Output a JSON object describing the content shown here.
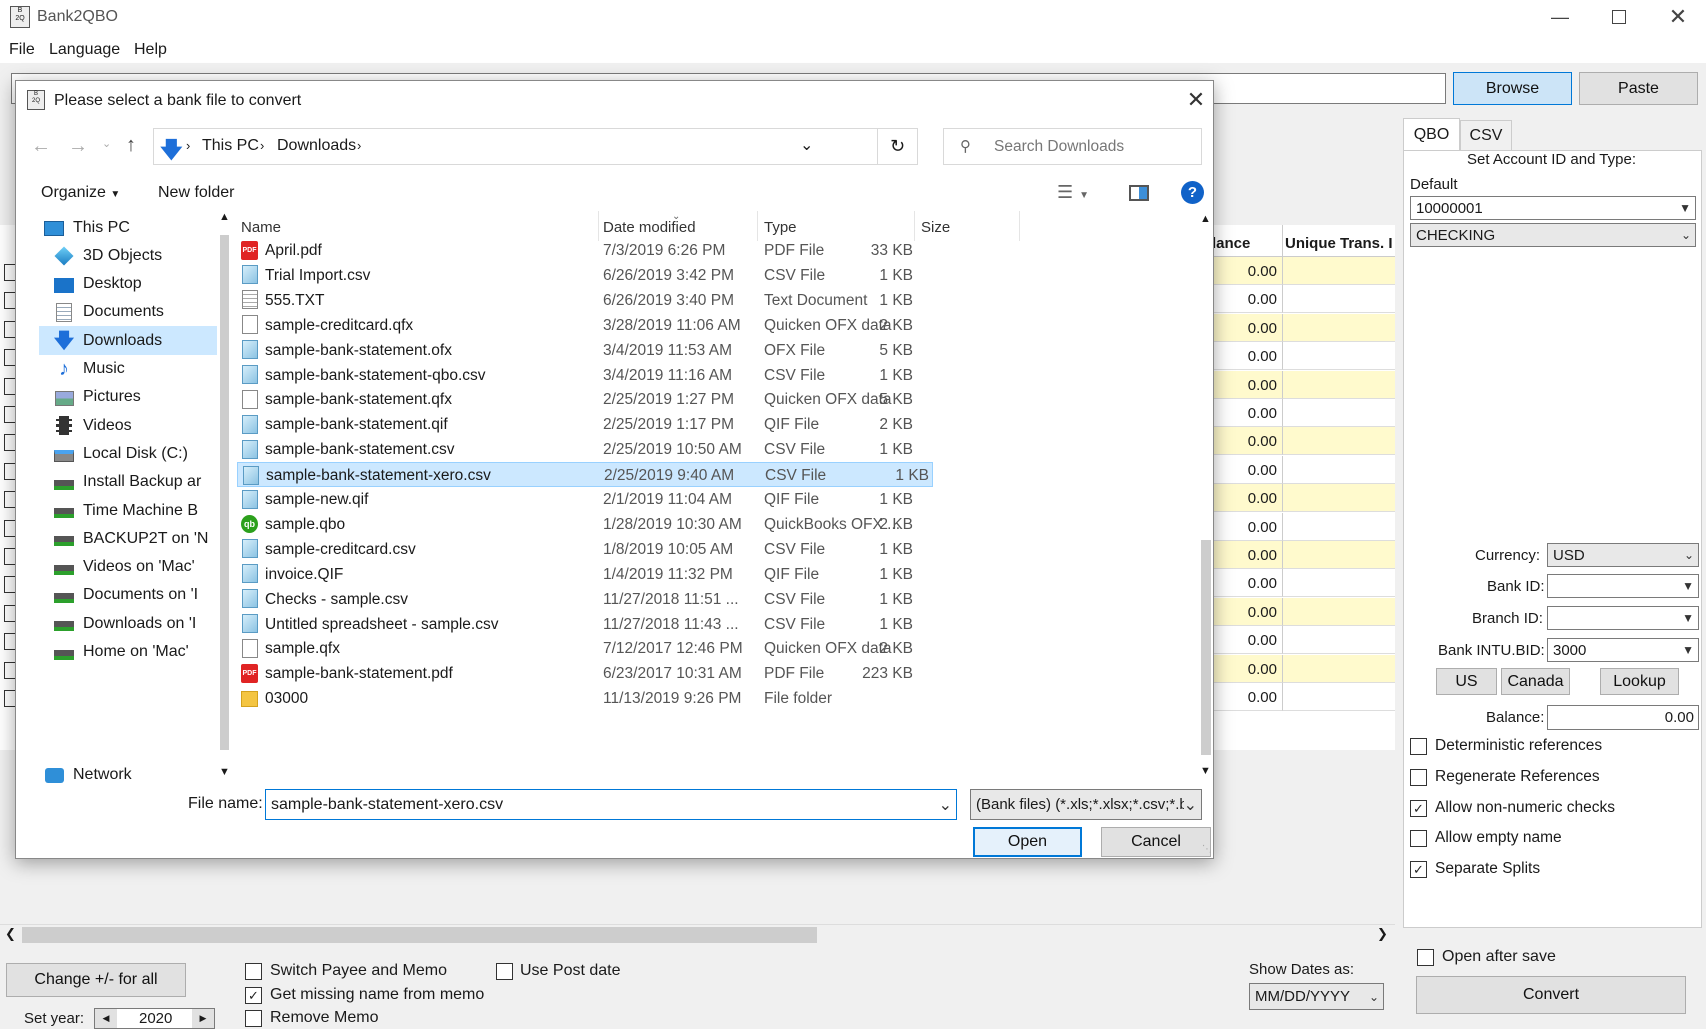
{
  "app": {
    "title": "Bank2QBO",
    "menu": [
      "File",
      "Language",
      "Help"
    ],
    "browse": "Browse",
    "paste": "Paste",
    "grid_headers": [
      "lance",
      "Unique Trans. I"
    ],
    "balances": [
      "0.00",
      "0.00",
      "0.00",
      "0.00",
      "0.00",
      "0.00",
      "0.00",
      "0.00",
      "0.00",
      "0.00",
      "0.00",
      "0.00",
      "0.00",
      "0.00",
      "0.00",
      "0.00"
    ],
    "right": {
      "tabs": [
        "QBO",
        "CSV"
      ],
      "set_account": "Set Account ID and Type:",
      "default_label": "Default",
      "account_id": "10000001",
      "account_type": "CHECKING",
      "currency_label": "Currency:",
      "currency": "USD",
      "bank_id_label": "Bank ID:",
      "bank_id": "",
      "branch_id_label": "Branch ID:",
      "branch_id": "",
      "intu_label": "Bank INTU.BID:",
      "intu_value": "3000",
      "us": "US",
      "canada": "Canada",
      "lookup": "Lookup",
      "balance_label": "Balance:",
      "balance_value": "0.00",
      "opts": [
        {
          "label": "Deterministic references",
          "checked": false
        },
        {
          "label": "Regenerate References",
          "checked": false
        },
        {
          "label": "Allow non-numeric checks",
          "checked": true
        },
        {
          "label": "Allow empty name",
          "checked": false
        },
        {
          "label": "Separate Splits",
          "checked": true
        }
      ],
      "open_after_save": "Open after save",
      "convert": "Convert"
    },
    "bottom": {
      "change_all": "Change +/- for all",
      "set_year_label": "Set year:",
      "year": "2020",
      "switch_payee": "Switch Payee and Memo",
      "get_missing": "Get missing name from memo",
      "remove_memo": "Remove Memo",
      "use_post_date": "Use Post date",
      "show_dates_label": "Show Dates as:",
      "date_format": "MM/DD/YYYY"
    }
  },
  "dialog": {
    "title": "Please select a bank file to convert",
    "breadcrumb": [
      "This PC",
      "Downloads"
    ],
    "search_placeholder": "Search Downloads",
    "organize": "Organize",
    "new_folder": "New folder",
    "nav": [
      {
        "label": "This PC",
        "icon": "computer-icon"
      },
      {
        "label": "3D Objects",
        "icon": "cube-icon"
      },
      {
        "label": "Desktop",
        "icon": "desktop-icon"
      },
      {
        "label": "Documents",
        "icon": "documents-icon"
      },
      {
        "label": "Downloads",
        "icon": "download-arrow-icon"
      },
      {
        "label": "Music",
        "icon": "music-icon"
      },
      {
        "label": "Pictures",
        "icon": "pictures-icon"
      },
      {
        "label": "Videos",
        "icon": "videos-icon"
      },
      {
        "label": "Local Disk (C:)",
        "icon": "disk-icon"
      },
      {
        "label": "Install Backup ar",
        "icon": "network-drive-icon"
      },
      {
        "label": "Time Machine B",
        "icon": "network-drive-icon"
      },
      {
        "label": "BACKUP2T on 'N",
        "icon": "network-drive-icon"
      },
      {
        "label": "Videos on 'Mac'",
        "icon": "network-drive-icon"
      },
      {
        "label": "Documents on 'I",
        "icon": "network-drive-icon"
      },
      {
        "label": "Downloads on 'I",
        "icon": "network-drive-icon"
      },
      {
        "label": "Home on 'Mac'",
        "icon": "network-drive-icon"
      },
      {
        "label": "Network",
        "icon": "network-icon"
      }
    ],
    "columns": {
      "name": "Name",
      "date": "Date modified",
      "type": "Type",
      "size": "Size"
    },
    "files": [
      {
        "name": "April.pdf",
        "date": "7/3/2019 6:26 PM",
        "type": "PDF File",
        "size": "33 KB",
        "icon": "pdf-icon"
      },
      {
        "name": "Trial Import.csv",
        "date": "6/26/2019 3:42 PM",
        "type": "CSV File",
        "size": "1 KB",
        "icon": "csv-file-icon"
      },
      {
        "name": "555.TXT",
        "date": "6/26/2019 3:40 PM",
        "type": "Text Document",
        "size": "1 KB",
        "icon": "text-file-icon"
      },
      {
        "name": "sample-creditcard.qfx",
        "date": "3/28/2019 11:06 AM",
        "type": "Quicken OFX data",
        "size": "2 KB",
        "icon": "blank-file-icon"
      },
      {
        "name": "sample-bank-statement.ofx",
        "date": "3/4/2019 11:53 AM",
        "type": "OFX File",
        "size": "5 KB",
        "icon": "csv-file-icon"
      },
      {
        "name": "sample-bank-statement-qbo.csv",
        "date": "3/4/2019 11:16 AM",
        "type": "CSV File",
        "size": "1 KB",
        "icon": "csv-file-icon"
      },
      {
        "name": "sample-bank-statement.qfx",
        "date": "2/25/2019 1:27 PM",
        "type": "Quicken OFX data",
        "size": "5 KB",
        "icon": "blank-file-icon"
      },
      {
        "name": "sample-bank-statement.qif",
        "date": "2/25/2019 1:17 PM",
        "type": "QIF File",
        "size": "2 KB",
        "icon": "csv-file-icon"
      },
      {
        "name": "sample-bank-statement.csv",
        "date": "2/25/2019 10:50 AM",
        "type": "CSV File",
        "size": "1 KB",
        "icon": "csv-file-icon"
      },
      {
        "name": "sample-bank-statement-xero.csv",
        "date": "2/25/2019 9:40 AM",
        "type": "CSV File",
        "size": "1 KB",
        "icon": "csv-file-icon"
      },
      {
        "name": "sample-new.qif",
        "date": "2/1/2019 11:04 AM",
        "type": "QIF File",
        "size": "1 KB",
        "icon": "csv-file-icon"
      },
      {
        "name": "sample.qbo",
        "date": "1/28/2019 10:30 AM",
        "type": "QuickBooks OFX ...",
        "size": "2 KB",
        "icon": "quickbooks-icon"
      },
      {
        "name": "sample-creditcard.csv",
        "date": "1/8/2019 10:05 AM",
        "type": "CSV File",
        "size": "1 KB",
        "icon": "csv-file-icon"
      },
      {
        "name": "invoice.QIF",
        "date": "1/4/2019 11:32 PM",
        "type": "QIF File",
        "size": "1 KB",
        "icon": "csv-file-icon"
      },
      {
        "name": "Checks - sample.csv",
        "date": "11/27/2018 11:51 ...",
        "type": "CSV File",
        "size": "1 KB",
        "icon": "csv-file-icon"
      },
      {
        "name": "Untitled spreadsheet - sample.csv",
        "date": "11/27/2018 11:43 ...",
        "type": "CSV File",
        "size": "1 KB",
        "icon": "csv-file-icon"
      },
      {
        "name": "sample.qfx",
        "date": "7/12/2017 12:46 PM",
        "type": "Quicken OFX data",
        "size": "2 KB",
        "icon": "blank-file-icon"
      },
      {
        "name": "sample-bank-statement.pdf",
        "date": "6/23/2017 10:31 AM",
        "type": "PDF File",
        "size": "223 KB",
        "icon": "pdf-icon"
      },
      {
        "name": "03000",
        "date": "11/13/2019 9:26 PM",
        "type": "File folder",
        "size": "",
        "icon": "folder-icon"
      }
    ],
    "selected_index": 9,
    "file_name_label": "File name:",
    "file_name": "sample-bank-statement-xero.csv",
    "filter": "(Bank files) (*.xls;*.xlsx;*.csv;*.b",
    "open": "Open",
    "cancel": "Cancel"
  }
}
